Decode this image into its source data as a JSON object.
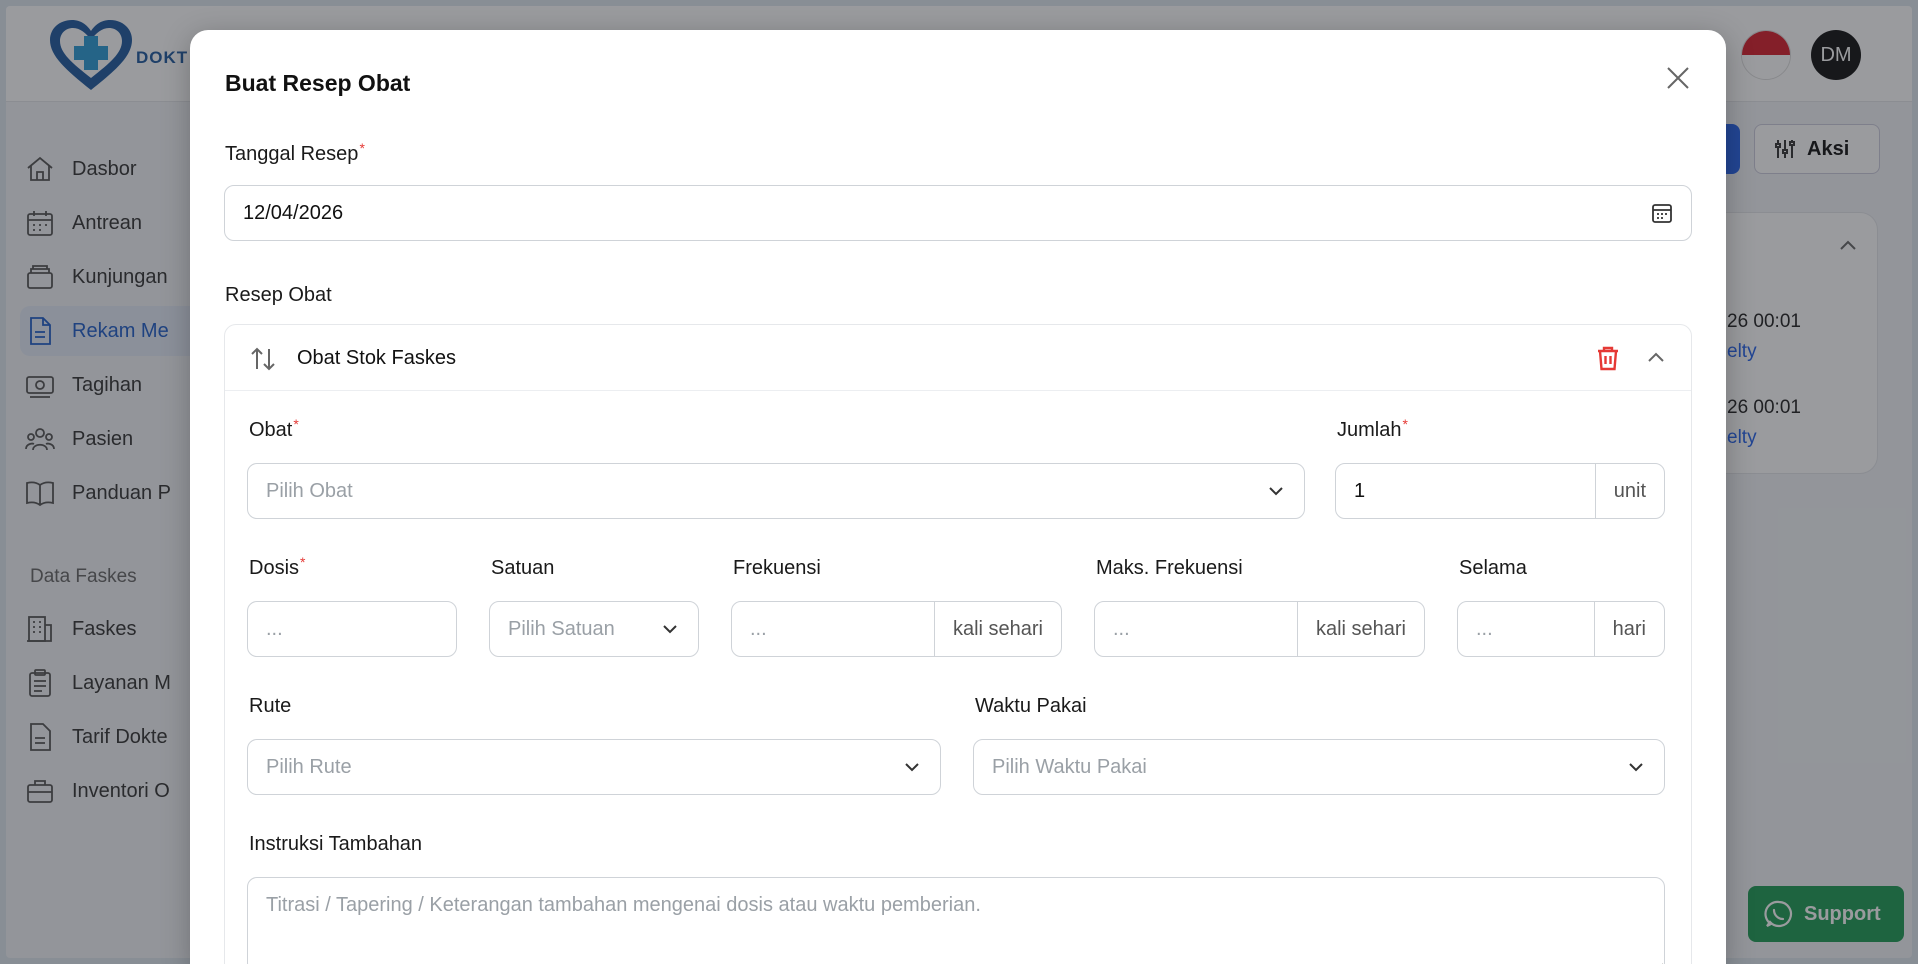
{
  "app": {
    "logo_text": "DOKT",
    "avatar_initials": "DM",
    "colors": {
      "primary": "#2563eb",
      "danger": "#e53935",
      "whatsapp": "#1e9b54"
    }
  },
  "sidebar": {
    "items": [
      {
        "label": "Dasbor",
        "icon": "home-icon"
      },
      {
        "label": "Antrean",
        "icon": "calendar-icon"
      },
      {
        "label": "Kunjungan",
        "icon": "inbox-icon"
      },
      {
        "label": "Rekam Me",
        "icon": "document-icon"
      },
      {
        "label": "Tagihan",
        "icon": "money-icon"
      },
      {
        "label": "Pasien",
        "icon": "users-icon"
      },
      {
        "label": "Panduan P",
        "icon": "book-icon"
      }
    ],
    "section_label": "Data Faskes",
    "section_items": [
      {
        "label": "Faskes",
        "icon": "building-icon"
      },
      {
        "label": "Layanan M",
        "icon": "clipboard-icon"
      },
      {
        "label": "Tarif Dokte",
        "icon": "file-icon"
      },
      {
        "label": "Inventori O",
        "icon": "briefcase-icon"
      }
    ]
  },
  "header_actions": {
    "aksi_label": "Aksi"
  },
  "bg_card": {
    "rows": [
      {
        "time": "26 00:01",
        "link": "elty"
      },
      {
        "time": "26 00:01",
        "link": "elty"
      }
    ]
  },
  "support": {
    "label": "Support"
  },
  "modal": {
    "title": "Buat Resep Obat",
    "tanggal_label": "Tanggal Resep",
    "tanggal_value": "12/04/2026",
    "resep_label": "Resep Obat",
    "section_title": "Obat Stok Faskes",
    "obat_label": "Obat",
    "obat_placeholder": "Pilih Obat",
    "jumlah_label": "Jumlah",
    "jumlah_value": "1",
    "jumlah_unit": "unit",
    "dosis_label": "Dosis",
    "dosis_placeholder": "...",
    "satuan_label": "Satuan",
    "satuan_placeholder": "Pilih Satuan",
    "frekuensi_label": "Frekuensi",
    "frekuensi_placeholder": "...",
    "frekuensi_unit": "kali sehari",
    "maks_label": "Maks. Frekuensi",
    "maks_placeholder": "...",
    "maks_unit": "kali sehari",
    "selama_label": "Selama",
    "selama_placeholder": "...",
    "selama_unit": "hari",
    "rute_label": "Rute",
    "rute_placeholder": "Pilih Rute",
    "waktu_label": "Waktu Pakai",
    "waktu_placeholder": "Pilih Waktu Pakai",
    "instruksi_label": "Instruksi Tambahan",
    "instruksi_placeholder": "Titrasi / Tapering / Keterangan tambahan mengenai dosis atau waktu pemberian."
  }
}
